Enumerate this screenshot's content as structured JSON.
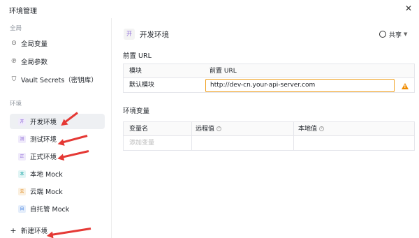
{
  "window": {
    "title": "环境管理",
    "close_glyph": "✕"
  },
  "sidebar": {
    "global_label": "全局",
    "global_items": [
      {
        "label": "全局变量",
        "icon": "global-variable-icon"
      },
      {
        "label": "全局参数",
        "icon": "global-param-icon"
      },
      {
        "label": "Vault Secrets（密钥库）",
        "icon": "shield-icon"
      }
    ],
    "env_label": "环境",
    "env_items": [
      {
        "label": "开发环境",
        "icon_text": "开",
        "icon_color": "#8f6ad8",
        "icon_bg": "#f0ebfb",
        "active": true
      },
      {
        "label": "测试环境",
        "icon_text": "测",
        "icon_color": "#8f6ad8",
        "icon_bg": "#f0ebfb",
        "active": false
      },
      {
        "label": "正式环境",
        "icon_text": "正",
        "icon_color": "#8f6ad8",
        "icon_bg": "#f0ebfb",
        "active": false
      },
      {
        "label": "本地 Mock",
        "icon_text": "本",
        "icon_color": "#19a5a5",
        "icon_bg": "#e2f5f5",
        "active": false
      },
      {
        "label": "云端 Mock",
        "icon_text": "云",
        "icon_color": "#e08a1e",
        "icon_bg": "#fbf0e0",
        "active": false
      },
      {
        "label": "自托管 Mock",
        "icon_text": "自",
        "icon_color": "#3a7be0",
        "icon_bg": "#e5eefb",
        "active": false
      }
    ],
    "new_env_label": "新建环境"
  },
  "main": {
    "badge_text": "开",
    "env_title": "开发环境",
    "share_label": "共享",
    "base_url_section": "前置 URL",
    "url_table": {
      "col_module": "模块",
      "col_base_url": "前置 URL",
      "row_module": "默认模块",
      "row_url_value": "http://dev-cn.your-api-server.com"
    },
    "vars_section": "环境变量",
    "var_table": {
      "col_name": "变量名",
      "col_remote": "远程值",
      "col_local": "本地值",
      "add_placeholder": "添加变量"
    }
  },
  "colors": {
    "accent_warning": "#f0a020",
    "annotation_arrow": "#e53935"
  }
}
